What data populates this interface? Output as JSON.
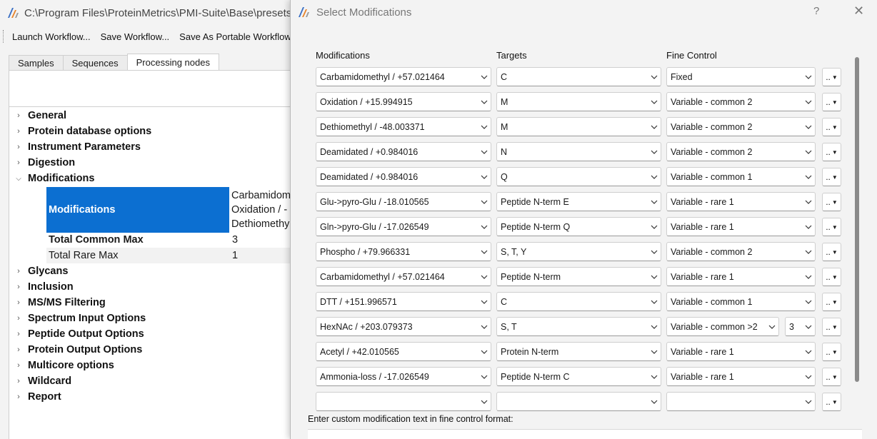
{
  "main_window": {
    "title": "C:\\Program Files\\ProteinMetrics\\PMI-Suite\\Base\\presets\\",
    "toolbar": [
      "Launch Workflow...",
      "Save Workflow...",
      "Save As Portable Workflow"
    ],
    "tabs": [
      {
        "label": "Samples",
        "active": false
      },
      {
        "label": "Sequences",
        "active": false
      },
      {
        "label": "Processing nodes",
        "active": true
      }
    ],
    "tree": {
      "nodes_top": [
        "General",
        "Protein database options",
        "Instrument Parameters",
        "Digestion"
      ],
      "expanded": "Modifications",
      "modifications_label": "Modifications",
      "modifications_value": [
        "Carbamidom",
        "Oxidation / -",
        "Dethiomethy"
      ],
      "total_common_max_label": "Total Common Max",
      "total_common_max_value": "3",
      "total_rare_max_label": "Total Rare Max",
      "total_rare_max_value": "1",
      "nodes_bottom": [
        "Glycans",
        "Inclusion",
        "MS/MS Filtering",
        "Spectrum Input Options",
        "Peptide Output Options",
        "Protein Output Options",
        "Multicore options",
        "Wildcard",
        "Report"
      ]
    }
  },
  "dialog": {
    "title": "Select Modifications",
    "help": "?",
    "close": "✕",
    "headers": {
      "modifications": "Modifications",
      "targets": "Targets",
      "fine_control": "Fine Control"
    },
    "dots_label": "..",
    "rows": [
      {
        "mod": "Carbamidomethyl / +57.021464",
        "target": "C",
        "fine": "Fixed"
      },
      {
        "mod": "Oxidation / +15.994915",
        "target": "M",
        "fine": "Variable - common 2"
      },
      {
        "mod": "Dethiomethyl / -48.003371",
        "target": "M",
        "fine": "Variable - common 2"
      },
      {
        "mod": "Deamidated / +0.984016",
        "target": "N",
        "fine": "Variable - common 2"
      },
      {
        "mod": "Deamidated / +0.984016",
        "target": "Q",
        "fine": "Variable - common 1"
      },
      {
        "mod": "Glu->pyro-Glu / -18.010565",
        "target": "Peptide N-term E",
        "fine": "Variable - rare 1"
      },
      {
        "mod": "Gln->pyro-Glu / -17.026549",
        "target": "Peptide N-term Q",
        "fine": "Variable - rare 1"
      },
      {
        "mod": "Phospho / +79.966331",
        "target": "S, T, Y",
        "fine": "Variable - common 2"
      },
      {
        "mod": "Carbamidomethyl / +57.021464",
        "target": "Peptide N-term",
        "fine": "Variable - rare 1"
      },
      {
        "mod": "DTT / +151.996571",
        "target": "C",
        "fine": "Variable - common 1"
      },
      {
        "mod": "HexNAc / +203.079373",
        "target": "S, T",
        "fine": "Variable - common >2",
        "extra": "3"
      },
      {
        "mod": "Acetyl / +42.010565",
        "target": "Protein N-term",
        "fine": "Variable - rare 1"
      },
      {
        "mod": "Ammonia-loss / -17.026549",
        "target": "Peptide N-term C",
        "fine": "Variable - rare 1"
      },
      {
        "mod": "",
        "target": "",
        "fine": ""
      }
    ],
    "custom_label": "Enter custom modification text in fine control format:",
    "custom_value": ""
  }
}
